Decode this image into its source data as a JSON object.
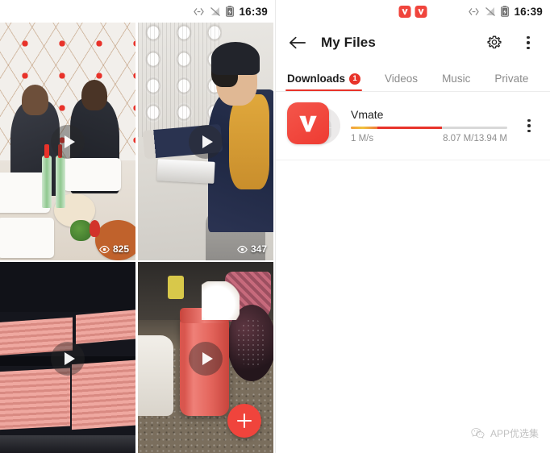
{
  "left": {
    "statusbar": {
      "time": "16:39",
      "icons": [
        "data-transfer-icon",
        "signal-off-icon",
        "battery-charging-icon"
      ]
    },
    "videos": [
      {
        "id": "video-1",
        "views": "825",
        "has_views": true,
        "scene": "two-men-eating-at-table"
      },
      {
        "id": "video-2",
        "views": "347",
        "has_views": true,
        "scene": "man-plastering-textured-wall"
      },
      {
        "id": "video-3",
        "views": "",
        "has_views": false,
        "scene": "pink-panel-stacks"
      },
      {
        "id": "video-4",
        "views": "",
        "has_views": false,
        "scene": "pink-jar-on-counter"
      }
    ],
    "fab": {
      "label": "+",
      "name": "add-button",
      "color": "#F0443C"
    }
  },
  "right": {
    "statusbar": {
      "time": "16:39",
      "notification_icons": [
        "vmate-icon",
        "vmate-icon"
      ],
      "icons": [
        "data-transfer-icon",
        "signal-off-icon",
        "battery-charging-icon"
      ]
    },
    "appbar": {
      "back_label": "Back",
      "title": "My Files",
      "settings_label": "Settings",
      "overflow_label": "More options"
    },
    "tabs": [
      {
        "label": "Downloads",
        "active": true,
        "badge": "1"
      },
      {
        "label": "Videos",
        "active": false,
        "badge": ""
      },
      {
        "label": "Music",
        "active": false,
        "badge": ""
      },
      {
        "label": "Private",
        "active": false,
        "badge": ""
      }
    ],
    "downloads": [
      {
        "name": "Vmate",
        "speed": "1 M/s",
        "size": "8.07 M/13.94 M",
        "progress_percent": 58,
        "orange_percent": 17,
        "more_label": "Item options"
      }
    ],
    "watermark": {
      "text": "APP优选集",
      "icon": "wechat-icon"
    }
  },
  "colors": {
    "accent_red": "#E8332A",
    "fab_red": "#F0443C",
    "progress_orange": "#F2A03C",
    "track_gray": "#D8D8D8",
    "text_primary": "#1C1C1C",
    "text_muted": "#8E8E8E"
  }
}
